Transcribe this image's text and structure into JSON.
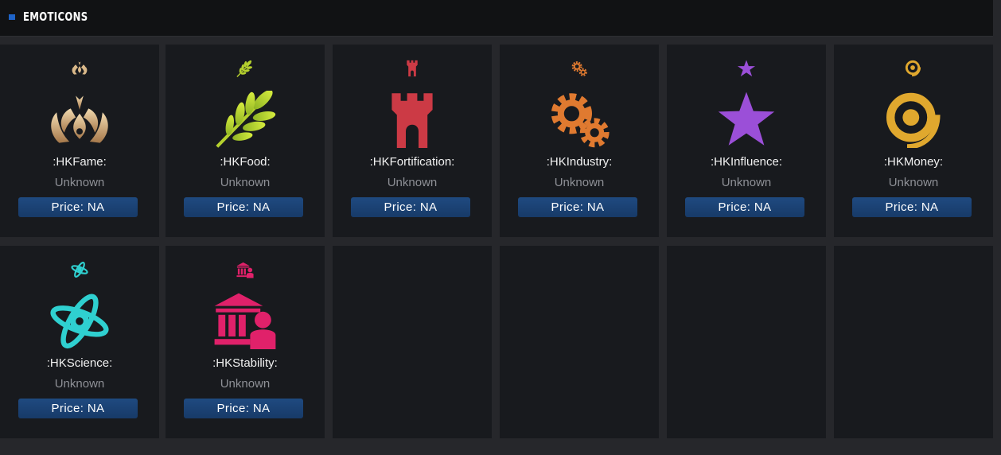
{
  "header": {
    "title": "EMOTICONS"
  },
  "emoticons": [
    {
      "name": ":HKFame:",
      "status": "Unknown",
      "price": "Price: NA",
      "icon": "fame-icon",
      "color": "#d9b889"
    },
    {
      "name": ":HKFood:",
      "status": "Unknown",
      "price": "Price: NA",
      "icon": "food-wheat-icon",
      "color": "#b5d12e"
    },
    {
      "name": ":HKFortification:",
      "status": "Unknown",
      "price": "Price: NA",
      "icon": "fortification-tower-icon",
      "color": "#cc3a45"
    },
    {
      "name": ":HKIndustry:",
      "status": "Unknown",
      "price": "Price: NA",
      "icon": "industry-gears-icon",
      "color": "#e07a30"
    },
    {
      "name": ":HKInfluence:",
      "status": "Unknown",
      "price": "Price: NA",
      "icon": "influence-star-icon",
      "color": "#9b4fd8"
    },
    {
      "name": ":HKMoney:",
      "status": "Unknown",
      "price": "Price: NA",
      "icon": "money-coin-icon",
      "color": "#e0a82e"
    },
    {
      "name": ":HKScience:",
      "status": "Unknown",
      "price": "Price: NA",
      "icon": "science-atom-icon",
      "color": "#2fd0d0"
    },
    {
      "name": ":HKStability:",
      "status": "Unknown",
      "price": "Price: NA",
      "icon": "stability-icon",
      "color": "#e0216a"
    }
  ]
}
